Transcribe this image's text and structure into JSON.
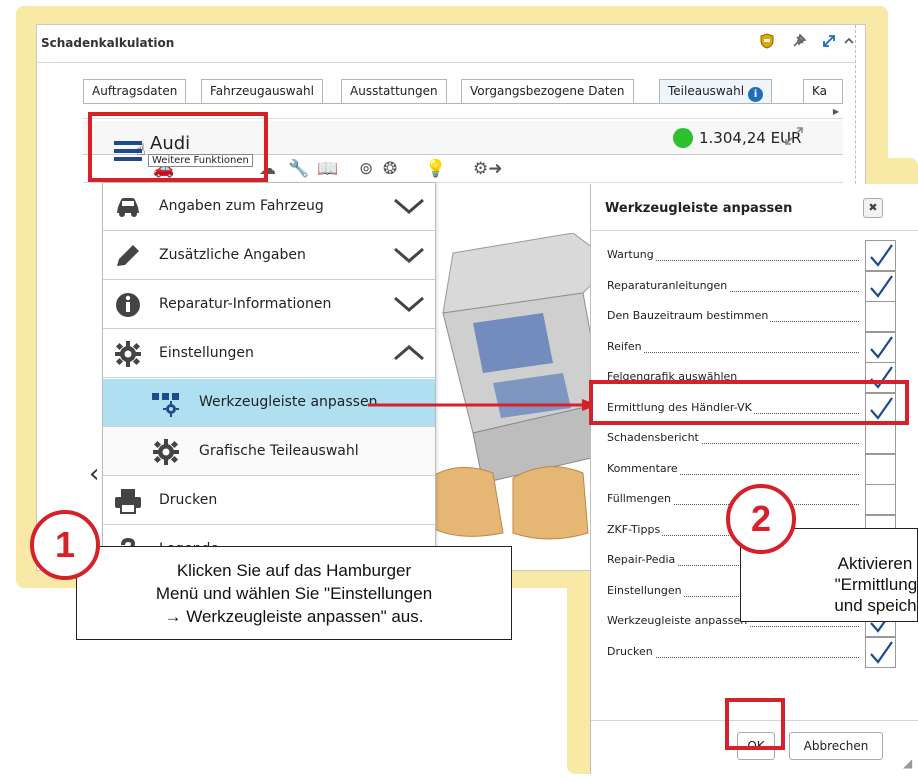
{
  "window": {
    "title": "Schadenkalkulation"
  },
  "tabs": [
    {
      "label": "Auftragsdaten"
    },
    {
      "label": "Fahrzeugauswahl"
    },
    {
      "label": "Ausstattungen"
    },
    {
      "label": "Vorgangsbezogene Daten"
    },
    {
      "label": "Teileauswahl",
      "info_icon": "info-icon"
    },
    {
      "label": "Ka"
    }
  ],
  "header": {
    "brand": "Audi",
    "tooltip": "Weitere Funktionen",
    "total": "1.304,24 EUR",
    "status_color": "#2dc22d"
  },
  "menu": {
    "items": [
      {
        "label": "Angaben zum Fahrzeug",
        "icon": "car-icon"
      },
      {
        "label": "Zusätzliche Angaben",
        "icon": "pencil-icon"
      },
      {
        "label": "Reparatur-Informationen",
        "icon": "info-icon"
      },
      {
        "label": "Einstellungen",
        "icon": "gear-icon"
      },
      {
        "label": "Werkzeugleiste anpassen",
        "icon": "toolbar-gear-icon",
        "highlighted": true
      },
      {
        "label": "Grafische Teileauswahl",
        "icon": "gear-icon"
      },
      {
        "label": "Drucken",
        "icon": "printer-icon"
      },
      {
        "label": "Legende",
        "icon": "help-icon"
      }
    ]
  },
  "dialog": {
    "title": "Werkzeugleiste anpassen",
    "rows": [
      {
        "label": "Wartung",
        "checked": true
      },
      {
        "label": "Reparaturanleitungen",
        "checked": true
      },
      {
        "label": "Den Bauzeitraum bestimmen",
        "checked": false
      },
      {
        "label": "Reifen",
        "checked": true
      },
      {
        "label": "Felgengrafik auswählen",
        "checked": true
      },
      {
        "label": "Ermittlung des Händler-VK",
        "checked": true
      },
      {
        "label": "Schadensbericht",
        "checked": false
      },
      {
        "label": "Kommentare",
        "checked": false
      },
      {
        "label": "Füllmengen",
        "checked": false
      },
      {
        "label": "ZKF-Tipps",
        "checked": false
      },
      {
        "label": "Repair-Pedia",
        "checked": false
      },
      {
        "label": "Einstellungen",
        "checked": false
      },
      {
        "label": "Werkzeugleiste anpassen",
        "checked": true
      },
      {
        "label": "Drucken",
        "checked": true
      }
    ],
    "ok_label": "OK",
    "cancel_label": "Abbrechen"
  },
  "callouts": {
    "step1_number": "1",
    "step1_line1": "Klicken Sie auf das Hamburger",
    "step1_line2": "Menü und wählen Sie \"Einstellungen",
    "step1_line3": "→ Werkzeugleiste anpassen\" aus.",
    "step2_number": "2",
    "step2_line1": "Aktivieren S",
    "step2_line2": "\"Ermittlung d",
    "step2_line3": "und speicher"
  },
  "colors": {
    "highlight_red": "#d6202a",
    "frame_yellow": "#f8eaa6",
    "menu_highlight": "#aee0f2",
    "check_blue": "#1b4b8a"
  }
}
